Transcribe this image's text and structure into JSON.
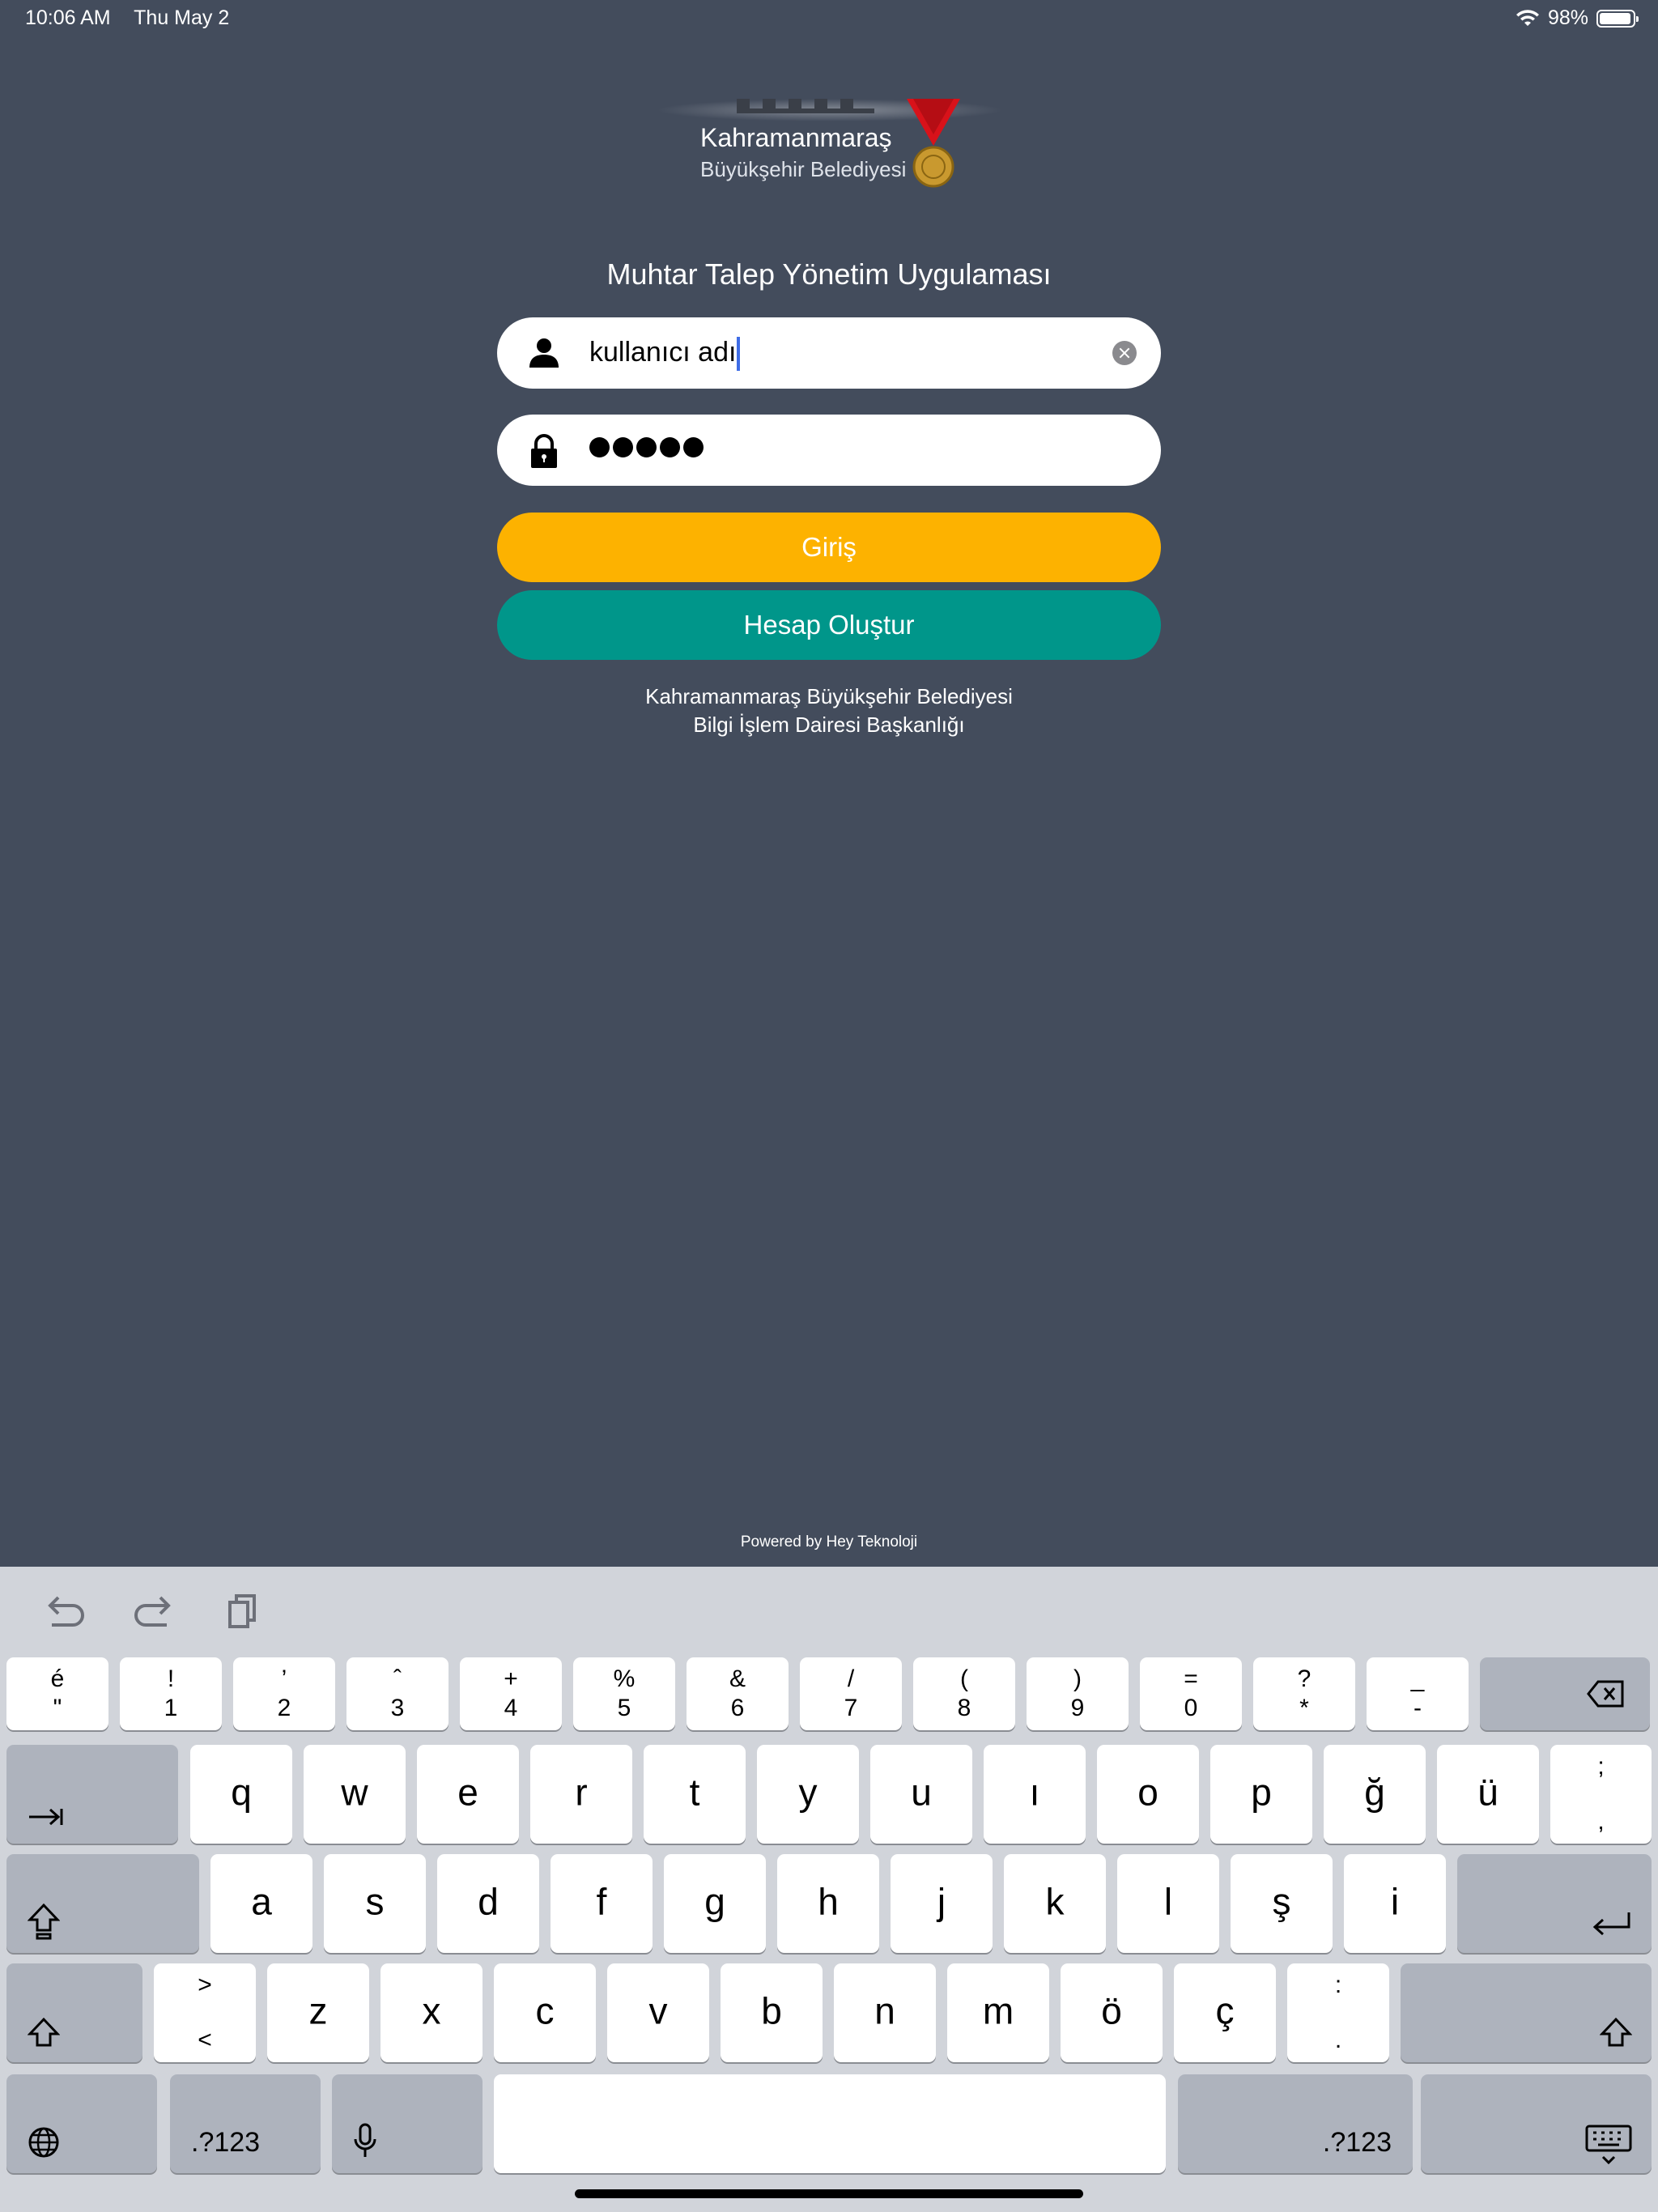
{
  "status": {
    "time": "10:06 AM",
    "date": "Thu May 2",
    "battery": "98%"
  },
  "logo": {
    "line1": "Kahramanmaraş",
    "line2": "Büyükşehir Belediyesi"
  },
  "title": "Muhtar Talep Yönetim Uygulaması",
  "username": {
    "value": "kullanıcı adı"
  },
  "password": {
    "masked_length": 5
  },
  "buttons": {
    "login": "Giriş",
    "create": "Hesap Oluştur"
  },
  "footer": {
    "line1": "Kahramanmaraş Büyükşehir Belediyesi",
    "line2": "Bilgi İşlem Dairesi Başkanlığı"
  },
  "powered_by": "Powered by Hey Teknoloji",
  "keyboard": {
    "row1": [
      [
        "é",
        "\""
      ],
      [
        "!",
        "1"
      ],
      [
        "’",
        "2"
      ],
      [
        "ˆ",
        "3"
      ],
      [
        "+",
        "4"
      ],
      [
        "%",
        "5"
      ],
      [
        "&",
        "6"
      ],
      [
        "/",
        "7"
      ],
      [
        "(",
        "8"
      ],
      [
        ")",
        "9"
      ],
      [
        "=",
        "0"
      ],
      [
        "?",
        "*"
      ],
      [
        "_",
        "-"
      ]
    ],
    "row2": [
      "q",
      "w",
      "e",
      "r",
      "t",
      "y",
      "u",
      "ı",
      "o",
      "p",
      "ğ",
      "ü"
    ],
    "row2_last": [
      ";",
      ","
    ],
    "row3": [
      "a",
      "s",
      "d",
      "f",
      "g",
      "h",
      "j",
      "k",
      "l",
      "ş",
      "i"
    ],
    "row4_first": [
      ">",
      "<"
    ],
    "row4": [
      "z",
      "x",
      "c",
      "v",
      "b",
      "n",
      "m",
      "ö",
      "ç"
    ],
    "row4_last": [
      ":",
      "."
    ],
    "numbers_label": ".?123"
  },
  "colors": {
    "background": "#434c5c",
    "login": "#fdb200",
    "create": "#00968a"
  }
}
